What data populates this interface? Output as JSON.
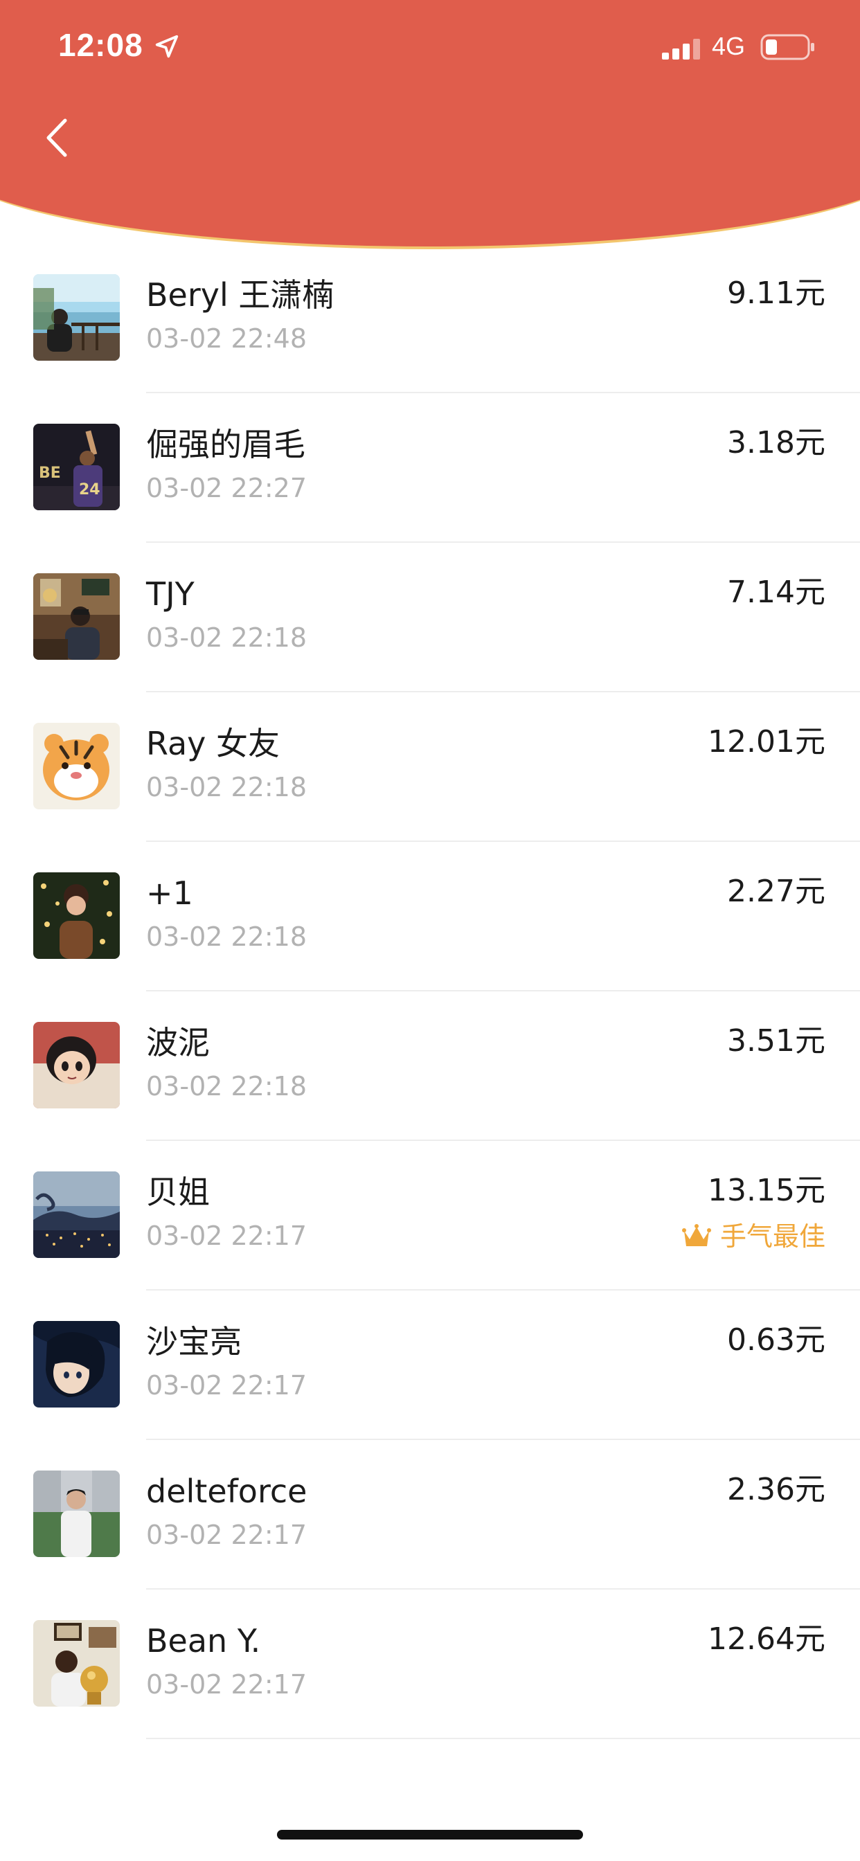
{
  "status_bar": {
    "time": "12:08",
    "network": "4G"
  },
  "header": {
    "back_icon": "chevron-left-icon",
    "accent_color": "#E05D4C",
    "edge_color": "#F3C66E"
  },
  "records": [
    {
      "name": "Beryl 王潇楠",
      "time": "03-02 22:48",
      "amount": "9.11元",
      "avatar": "sea-railing-photo"
    },
    {
      "name": "倔强的眉毛",
      "time": "03-02 22:27",
      "amount": "3.18元",
      "avatar": "basketball-jersey-photo"
    },
    {
      "name": "TJY",
      "time": "03-02 22:18",
      "amount": "7.14元",
      "avatar": "cafe-portrait-photo"
    },
    {
      "name": "Ray 女友",
      "time": "03-02 22:18",
      "amount": "12.01元",
      "avatar": "cartoon-tiger"
    },
    {
      "name": "+1",
      "time": "03-02 22:18",
      "amount": "2.27元",
      "avatar": "christmas-tree-portrait"
    },
    {
      "name": "波泥",
      "time": "03-02 22:18",
      "amount": "3.51元",
      "avatar": "anime-girl"
    },
    {
      "name": "贝姐",
      "time": "03-02 22:17",
      "amount": "13.15元",
      "avatar": "night-city-view",
      "badge": "手气最佳"
    },
    {
      "name": "沙宝亮",
      "time": "03-02 22:17",
      "amount": "0.63元",
      "avatar": "anime-boy"
    },
    {
      "name": "delteforce",
      "time": "03-02 22:17",
      "amount": "2.36元",
      "avatar": "outdoor-portrait"
    },
    {
      "name": "Bean Y.",
      "time": "03-02 22:17",
      "amount": "12.64元",
      "avatar": "trophy-photo"
    }
  ],
  "badge_color": "#F0A73A"
}
